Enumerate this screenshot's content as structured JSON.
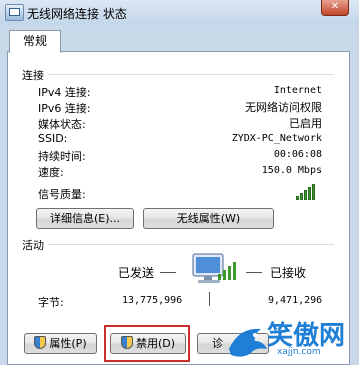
{
  "window": {
    "title": "无线网络连接 状态",
    "close_glyph": "✕"
  },
  "tabs": [
    {
      "label": "常规"
    }
  ],
  "connection": {
    "group_label": "连接",
    "rows": [
      {
        "label": "IPv4 连接:",
        "value": "Internet"
      },
      {
        "label": "IPv6 连接:",
        "value": "无网络访问权限"
      },
      {
        "label": "媒体状态:",
        "value": "已启用"
      },
      {
        "label": "SSID:",
        "value": "ZYDX-PC_Network"
      },
      {
        "label": "持续时间:",
        "value": "00:06:08"
      },
      {
        "label": "速度:",
        "value": "150.0 Mbps"
      }
    ],
    "signal_label": "信号质量:",
    "signal_strength": 5,
    "signal_max": 5,
    "details_button": "详细信息(E)...",
    "wireless_props_button": "无线属性(W)"
  },
  "activity": {
    "group_label": "活动",
    "sent_label": "已发送",
    "received_label": "已接收",
    "bytes_label": "字节:",
    "bytes_sent": "13,775,996",
    "bytes_received": "9,471,296"
  },
  "buttons": {
    "properties": "属性(P)",
    "disable": "禁用(D)",
    "diagnose": "诊"
  },
  "watermark": {
    "text": "笑傲网",
    "url": "xajjn.com"
  },
  "colors": {
    "highlight": "#c9302c",
    "signal": "#3c9a2a",
    "brand": "#1f7fd6"
  }
}
